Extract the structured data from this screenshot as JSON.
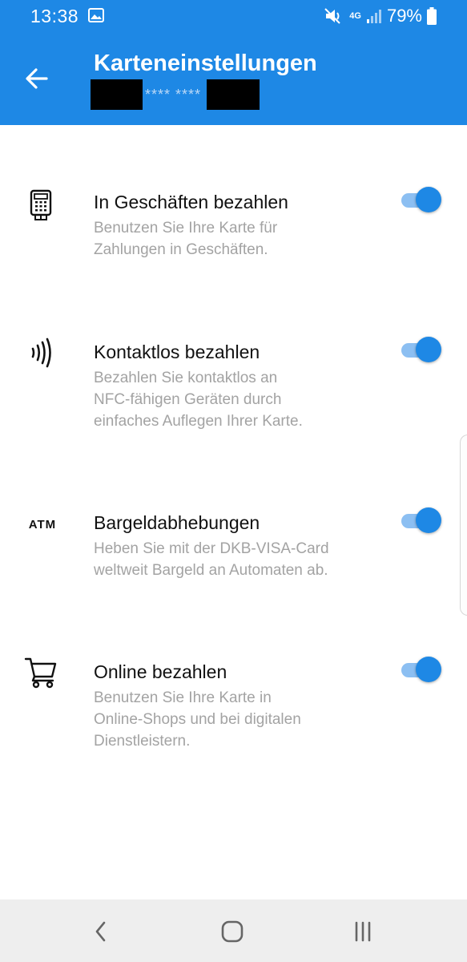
{
  "status_bar": {
    "time": "13:38",
    "network": "4G",
    "battery": "79%"
  },
  "app_bar": {
    "title": "Karteneinstellungen",
    "card_masked": "**** ****"
  },
  "settings": [
    {
      "title": "In Geschäften bezahlen",
      "description": [
        "Benutzen Sie Ihre Karte für",
        "Zahlungen in Geschäften."
      ],
      "icon": "card-terminal-icon",
      "enabled": true
    },
    {
      "title": "Kontaktlos bezahlen",
      "description": [
        "Bezahlen Sie kontaktlos an",
        "NFC-fähigen Geräten durch",
        "einfaches Auflegen Ihrer Karte."
      ],
      "icon": "contactless-icon",
      "enabled": true
    },
    {
      "title": "Bargeldabhebungen",
      "description": [
        "Heben Sie mit der DKB-VISA-Card",
        "weltweit Bargeld an Automaten ab."
      ],
      "icon": "atm-icon",
      "icon_text": "ATM",
      "enabled": true
    },
    {
      "title": "Online bezahlen",
      "description": [
        "Benutzen Sie Ihre Karte in",
        "Online-Shops und bei digitalen",
        "Dienstleistern."
      ],
      "icon": "shopping-cart-icon",
      "enabled": true
    }
  ],
  "colors": {
    "primary": "#1e88e5",
    "switch_track": "#8cbff2",
    "secondary_text": "#a3a3a3"
  },
  "nav_bar": {
    "buttons": [
      "back",
      "home",
      "recents"
    ]
  }
}
